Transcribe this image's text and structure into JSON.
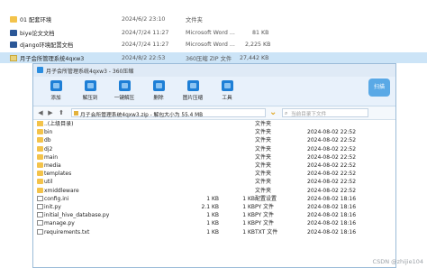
{
  "explorer": {
    "rows": [
      {
        "name": "01 配套环境",
        "date": "2024/6/2 23:10",
        "type": "文件夹",
        "size": "",
        "icon": "folder-icon",
        "selected": false
      },
      {
        "name": "biye论文文档",
        "date": "2024/7/24 11:27",
        "type": "Microsoft Word ...",
        "size": "81 KB",
        "icon": "word-icon",
        "selected": false
      },
      {
        "name": "django环境配置文档",
        "date": "2024/7/24 11:27",
        "type": "Microsoft Word ...",
        "size": "2,225 KB",
        "icon": "word-icon",
        "selected": false
      },
      {
        "name": "月子会所管理系统4qxw3",
        "date": "2024/8/2 22:53",
        "type": "360压缩 ZIP 文件",
        "size": "27,442 KB",
        "icon": "zip-icon",
        "selected": true
      }
    ]
  },
  "zip": {
    "title": "月子会所管理系统4qxw3 - 360压缩",
    "toolbar": [
      "添加",
      "解压到",
      "一键解压",
      "删除",
      "图片压缩",
      "工具"
    ],
    "logo": "扫描",
    "address": "月子会所管理系统4qxw3.zip - 解包大小为 55.4 MB",
    "search_placeholder": "当前目录下文件",
    "files": [
      {
        "name": "..(上级目录)",
        "size": "",
        "packed": "",
        "type": "文件夹",
        "date": "",
        "icon": "up-folder-icon"
      },
      {
        "name": "bin",
        "size": "",
        "packed": "",
        "type": "文件夹",
        "date": "2024-08-02 22:52",
        "icon": "folder-icon"
      },
      {
        "name": "db",
        "size": "",
        "packed": "",
        "type": "文件夹",
        "date": "2024-08-02 22:52",
        "icon": "folder-icon"
      },
      {
        "name": "dj2",
        "size": "",
        "packed": "",
        "type": "文件夹",
        "date": "2024-08-02 22:52",
        "icon": "folder-icon"
      },
      {
        "name": "main",
        "size": "",
        "packed": "",
        "type": "文件夹",
        "date": "2024-08-02 22:52",
        "icon": "folder-icon"
      },
      {
        "name": "media",
        "size": "",
        "packed": "",
        "type": "文件夹",
        "date": "2024-08-02 22:52",
        "icon": "folder-icon"
      },
      {
        "name": "templates",
        "size": "",
        "packed": "",
        "type": "文件夹",
        "date": "2024-08-02 22:52",
        "icon": "folder-icon"
      },
      {
        "name": "util",
        "size": "",
        "packed": "",
        "type": "文件夹",
        "date": "2024-08-02 22:52",
        "icon": "folder-icon"
      },
      {
        "name": "xmiddleware",
        "size": "",
        "packed": "",
        "type": "文件夹",
        "date": "2024-08-02 22:52",
        "icon": "folder-icon"
      },
      {
        "name": "config.ini",
        "size": "1 KB",
        "packed": "1 KB",
        "type": "配置设置",
        "date": "2024-08-02 18:16",
        "icon": "file-icon"
      },
      {
        "name": "init.py",
        "size": "2.1 KB",
        "packed": "1 KB",
        "type": "PY 文件",
        "date": "2024-08-02 18:16",
        "icon": "file-icon"
      },
      {
        "name": "initial_hive_database.py",
        "size": "1 KB",
        "packed": "1 KB",
        "type": "PY 文件",
        "date": "2024-08-02 18:16",
        "icon": "file-icon"
      },
      {
        "name": "manage.py",
        "size": "1 KB",
        "packed": "1 KB",
        "type": "PY 文件",
        "date": "2024-08-02 18:16",
        "icon": "file-icon"
      },
      {
        "name": "requirements.txt",
        "size": "1 KB",
        "packed": "1 KB",
        "type": "TXT 文件",
        "date": "2024-08-02 18:16",
        "icon": "file-icon"
      }
    ]
  },
  "watermark": "CSDN @zhijie104"
}
